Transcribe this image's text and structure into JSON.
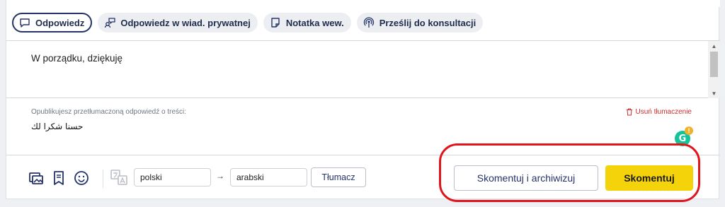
{
  "tabs": [
    {
      "label": "Odpowiedz",
      "icon": "speech-bubble-icon",
      "active": true
    },
    {
      "label": "Odpowiedz w wiad. prywatnej",
      "icon": "private-message-icon",
      "active": false
    },
    {
      "label": "Notatka wew.",
      "icon": "sticky-note-icon",
      "active": false
    },
    {
      "label": "Prześlij do konsultacji",
      "icon": "broadcast-icon",
      "active": false
    }
  ],
  "editor": {
    "text": "W porządku, dziękuję"
  },
  "translation": {
    "publish_label": "Opublikujesz przetłumaczoną odpowiedź o treści:",
    "remove_label": "Usuń tłumaczenie",
    "translated_text": "حسنا شكرا لك"
  },
  "toolbar": {
    "icons": [
      "image-gallery-icon",
      "bookmark-icon",
      "emoji-icon",
      "translate-icon"
    ],
    "source_language": "polski",
    "target_language": "arabski",
    "arrow": "→",
    "translate_label": "Tłumacz",
    "archive_label": "Skomentuj i archiwizuj",
    "comment_label": "Skomentuj"
  },
  "colors": {
    "accent_navy": "#24336a",
    "primary_yellow": "#f4d30a",
    "danger_red": "#d12c2c",
    "highlight_red": "#e1141b",
    "grammarly_green": "#15c39a"
  }
}
